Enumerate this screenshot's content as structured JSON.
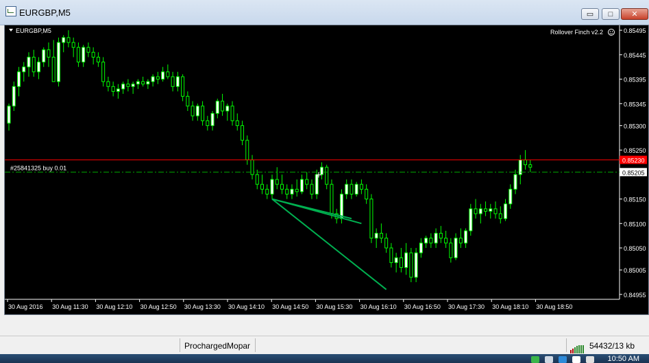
{
  "window": {
    "title": "EURGBP,M5",
    "minimize_glyph": "▭",
    "maximize_glyph": "□",
    "close_glyph": "✕"
  },
  "chart": {
    "symbol_label": "EURGBP,M5",
    "indicator_label": "Rollover Finch v2.2",
    "order_label": "#25841325 buy 0.01",
    "current_price": "0.85230",
    "order_price": "0.85205",
    "colors": {
      "background": "#000000",
      "candle": "#00ff00",
      "candle_fill": "#ffffff",
      "ask_line": "#ff0000",
      "order_line": "#00aa00",
      "trendline": "#00b050",
      "text": "#ffffff"
    }
  },
  "chart_data": {
    "type": "candlestick",
    "y_ticks": [
      "0.85495",
      "0.85445",
      "0.85395",
      "0.85345",
      "0.85300",
      "0.85250",
      "0.85205",
      "0.85150",
      "0.85100",
      "0.85050",
      "0.85005",
      "0.84955"
    ],
    "x_ticks": [
      "30 Aug 2016",
      "30 Aug 11:30",
      "30 Aug 12:10",
      "30 Aug 12:50",
      "30 Aug 13:30",
      "30 Aug 14:10",
      "30 Aug 14:50",
      "30 Aug 15:30",
      "30 Aug 16:10",
      "30 Aug 16:50",
      "30 Aug 17:30",
      "30 Aug 18:10",
      "30 Aug 18:50"
    ],
    "ylim": [
      0.84945,
      0.85505
    ],
    "ask_price": 0.8523,
    "order_price": 0.85205,
    "candles": [
      [
        0.85305,
        0.85345,
        0.8529,
        0.8534
      ],
      [
        0.8534,
        0.8539,
        0.8533,
        0.8538
      ],
      [
        0.8538,
        0.8542,
        0.8536,
        0.8541
      ],
      [
        0.8541,
        0.8543,
        0.8539,
        0.8542
      ],
      [
        0.8542,
        0.8545,
        0.854,
        0.8544
      ],
      [
        0.8544,
        0.85455,
        0.854,
        0.8541
      ],
      [
        0.8541,
        0.8544,
        0.85395,
        0.8543
      ],
      [
        0.8543,
        0.8546,
        0.8542,
        0.85455
      ],
      [
        0.85455,
        0.8547,
        0.8542,
        0.8544
      ],
      [
        0.8544,
        0.85475,
        0.854,
        0.8539
      ],
      [
        0.8539,
        0.8548,
        0.8538,
        0.8547
      ],
      [
        0.8547,
        0.85485,
        0.8545,
        0.8548
      ],
      [
        0.8548,
        0.85495,
        0.8546,
        0.8547
      ],
      [
        0.8547,
        0.8548,
        0.8544,
        0.8546
      ],
      [
        0.8546,
        0.8547,
        0.8542,
        0.8543
      ],
      [
        0.8543,
        0.85465,
        0.8542,
        0.8546
      ],
      [
        0.8546,
        0.8547,
        0.8544,
        0.8545
      ],
      [
        0.8545,
        0.8546,
        0.85425,
        0.8544
      ],
      [
        0.8544,
        0.8545,
        0.8542,
        0.8543
      ],
      [
        0.8543,
        0.8544,
        0.8538,
        0.8539
      ],
      [
        0.8539,
        0.854,
        0.8537,
        0.8538
      ],
      [
        0.8538,
        0.8539,
        0.8536,
        0.8537
      ],
      [
        0.8537,
        0.85385,
        0.85355,
        0.85375
      ],
      [
        0.85375,
        0.8539,
        0.85365,
        0.85385
      ],
      [
        0.85385,
        0.85395,
        0.8537,
        0.8538
      ],
      [
        0.8538,
        0.8539,
        0.85365,
        0.85385
      ],
      [
        0.85385,
        0.85395,
        0.85375,
        0.8539
      ],
      [
        0.8539,
        0.854,
        0.8538,
        0.85385
      ],
      [
        0.85385,
        0.85395,
        0.85375,
        0.8539
      ],
      [
        0.8539,
        0.85405,
        0.8538,
        0.854
      ],
      [
        0.854,
        0.8541,
        0.85385,
        0.85395
      ],
      [
        0.85395,
        0.8542,
        0.8539,
        0.8541
      ],
      [
        0.8541,
        0.85425,
        0.85395,
        0.854
      ],
      [
        0.854,
        0.8541,
        0.8537,
        0.8538
      ],
      [
        0.8538,
        0.8541,
        0.8537,
        0.854
      ],
      [
        0.854,
        0.85405,
        0.8535,
        0.8536
      ],
      [
        0.8536,
        0.8537,
        0.8533,
        0.8534
      ],
      [
        0.8534,
        0.8535,
        0.8531,
        0.8532
      ],
      [
        0.8532,
        0.85345,
        0.8531,
        0.8534
      ],
      [
        0.8534,
        0.8535,
        0.853,
        0.8531
      ],
      [
        0.8531,
        0.8532,
        0.8529,
        0.853
      ],
      [
        0.853,
        0.8533,
        0.8529,
        0.85325
      ],
      [
        0.85325,
        0.85355,
        0.85315,
        0.8535
      ],
      [
        0.8535,
        0.85365,
        0.8532,
        0.8533
      ],
      [
        0.8533,
        0.85345,
        0.8531,
        0.8534
      ],
      [
        0.8534,
        0.8535,
        0.853,
        0.8531
      ],
      [
        0.8531,
        0.85325,
        0.8529,
        0.853
      ],
      [
        0.853,
        0.8531,
        0.8526,
        0.8527
      ],
      [
        0.8527,
        0.8528,
        0.8522,
        0.8523
      ],
      [
        0.8523,
        0.8524,
        0.8519,
        0.852
      ],
      [
        0.852,
        0.8521,
        0.8517,
        0.8518
      ],
      [
        0.8518,
        0.852,
        0.8516,
        0.8517
      ],
      [
        0.8517,
        0.8518,
        0.8515,
        0.8516
      ],
      [
        0.8516,
        0.852,
        0.8515,
        0.8519
      ],
      [
        0.8519,
        0.85215,
        0.8517,
        0.8518
      ],
      [
        0.8518,
        0.852,
        0.8516,
        0.8517
      ],
      [
        0.8517,
        0.8518,
        0.8515,
        0.8516
      ],
      [
        0.8516,
        0.8518,
        0.8515,
        0.8517
      ],
      [
        0.8517,
        0.8519,
        0.85155,
        0.85165
      ],
      [
        0.85165,
        0.852,
        0.8516,
        0.8519
      ],
      [
        0.8519,
        0.85205,
        0.8517,
        0.8518
      ],
      [
        0.8518,
        0.8519,
        0.8515,
        0.8516
      ],
      [
        0.8516,
        0.8521,
        0.8515,
        0.852
      ],
      [
        0.852,
        0.85225,
        0.8519,
        0.85215
      ],
      [
        0.85215,
        0.8522,
        0.8517,
        0.8518
      ],
      [
        0.8518,
        0.8519,
        0.8511,
        0.8512
      ],
      [
        0.8512,
        0.8513,
        0.851,
        0.8511
      ],
      [
        0.8511,
        0.8517,
        0.851,
        0.8516
      ],
      [
        0.8516,
        0.8519,
        0.8515,
        0.8518
      ],
      [
        0.8518,
        0.8519,
        0.8515,
        0.8516
      ],
      [
        0.8516,
        0.85185,
        0.85155,
        0.8518
      ],
      [
        0.8518,
        0.8519,
        0.8516,
        0.8517
      ],
      [
        0.8517,
        0.8518,
        0.8514,
        0.8515
      ],
      [
        0.8515,
        0.8516,
        0.8506,
        0.8507
      ],
      [
        0.8507,
        0.8509,
        0.8505,
        0.8508
      ],
      [
        0.8508,
        0.851,
        0.8506,
        0.8507
      ],
      [
        0.8507,
        0.8508,
        0.8504,
        0.8505
      ],
      [
        0.8505,
        0.8506,
        0.8501,
        0.8502
      ],
      [
        0.8502,
        0.8504,
        0.85,
        0.8503
      ],
      [
        0.8503,
        0.8505,
        0.85,
        0.8501
      ],
      [
        0.8501,
        0.8506,
        0.84995,
        0.8504
      ],
      [
        0.8504,
        0.8505,
        0.8498,
        0.8499
      ],
      [
        0.8499,
        0.8505,
        0.8498,
        0.8504
      ],
      [
        0.8504,
        0.8507,
        0.8503,
        0.8506
      ],
      [
        0.8506,
        0.85075,
        0.8505,
        0.8507
      ],
      [
        0.8507,
        0.8508,
        0.8505,
        0.8506
      ],
      [
        0.8506,
        0.8509,
        0.8505,
        0.8508
      ],
      [
        0.8508,
        0.85095,
        0.8506,
        0.8507
      ],
      [
        0.8507,
        0.85085,
        0.8505,
        0.8506
      ],
      [
        0.8506,
        0.8507,
        0.8502,
        0.8503
      ],
      [
        0.8503,
        0.8508,
        0.85025,
        0.8507
      ],
      [
        0.8507,
        0.8509,
        0.8505,
        0.8506
      ],
      [
        0.8506,
        0.8509,
        0.8505,
        0.85085
      ],
      [
        0.85085,
        0.8514,
        0.85075,
        0.8513
      ],
      [
        0.8513,
        0.8515,
        0.8511,
        0.8512
      ],
      [
        0.8512,
        0.8514,
        0.851,
        0.8513
      ],
      [
        0.8513,
        0.85145,
        0.85115,
        0.85125
      ],
      [
        0.85125,
        0.8514,
        0.8511,
        0.8513
      ],
      [
        0.8513,
        0.85145,
        0.8511,
        0.8512
      ],
      [
        0.8512,
        0.85135,
        0.851,
        0.8511
      ],
      [
        0.8511,
        0.8515,
        0.85105,
        0.8514
      ],
      [
        0.8514,
        0.8518,
        0.8513,
        0.8517
      ],
      [
        0.8517,
        0.8521,
        0.8516,
        0.852
      ],
      [
        0.852,
        0.8524,
        0.8518,
        0.8523
      ],
      [
        0.8523,
        0.8525,
        0.8521,
        0.8522
      ],
      [
        0.8522,
        0.8523,
        0.85205,
        0.85215
      ]
    ],
    "trendlines": [
      {
        "from_index": 53,
        "to_index": 76,
        "from_price": 0.8515,
        "to_price": 0.84965
      },
      {
        "from_index": 53,
        "to_index": 69,
        "from_price": 0.8515,
        "to_price": 0.8511
      },
      {
        "from_index": 53,
        "to_index": 71,
        "from_price": 0.8515,
        "to_price": 0.851
      }
    ]
  },
  "status": {
    "profile": "ProchargedMopar",
    "traffic": "54432/13 kb",
    "clock": "10:50 AM"
  }
}
